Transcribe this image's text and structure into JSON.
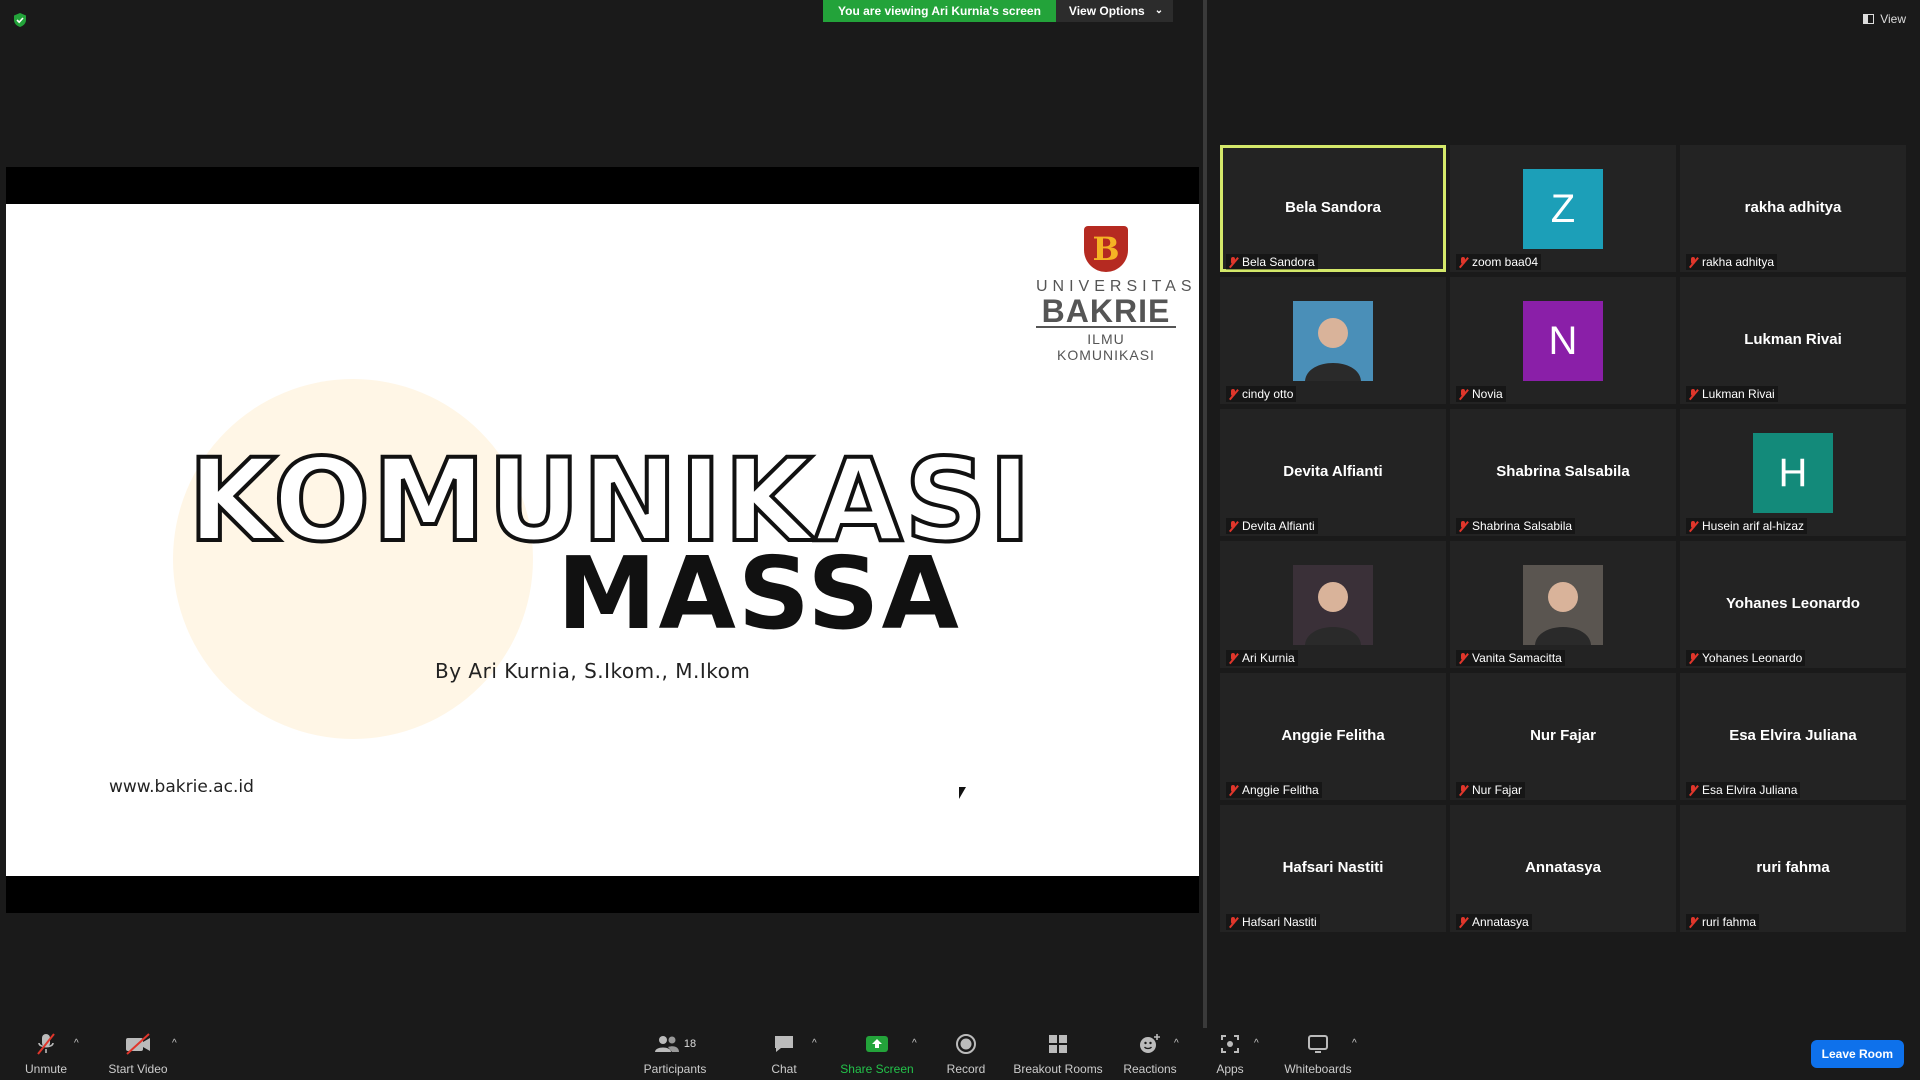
{
  "banner": {
    "viewing_text": "You are viewing Ari Kurnia's screen",
    "view_options": "View Options"
  },
  "top_right": {
    "view_label": "View"
  },
  "slide": {
    "title_outline": "KOMUNIKASI",
    "title_solid": "MASSA",
    "byline": "By Ari Kurnia, S.Ikom., M.Ikom",
    "website": "www.bakrie.ac.id",
    "logo": {
      "mark": "B",
      "line1": "UNIVERSITAS",
      "line2": "BAKRIE",
      "line3": "ILMU KOMUNIKASI"
    }
  },
  "participants": [
    {
      "center": "Bela Sandora",
      "label": "Bela Sandora",
      "type": "name",
      "active": true
    },
    {
      "center": "Z",
      "label": "zoom baa04",
      "type": "letter",
      "color": "#1c9fb8"
    },
    {
      "center": "rakha adhitya",
      "label": "rakha adhitya",
      "type": "name"
    },
    {
      "center": "",
      "label": "cindy otto",
      "type": "photo",
      "color": "#4a8fb8"
    },
    {
      "center": "N",
      "label": "Novia",
      "type": "letter",
      "color": "#8a1fa8"
    },
    {
      "center": "Lukman Rivai",
      "label": "Lukman Rivai",
      "type": "name"
    },
    {
      "center": "Devita Alfianti",
      "label": "Devita Alfianti",
      "type": "name"
    },
    {
      "center": "Shabrina Salsabila",
      "label": "Shabrina Salsabila",
      "type": "name"
    },
    {
      "center": "H",
      "label": "Husein arif al-hizaz",
      "type": "letter",
      "color": "#138a7a"
    },
    {
      "center": "",
      "label": "Ari Kurnia",
      "type": "photo",
      "color": "#3a3038"
    },
    {
      "center": "",
      "label": "Vanita Samacitta",
      "type": "photo",
      "color": "#5a5550"
    },
    {
      "center": "Yohanes Leonardo",
      "label": "Yohanes Leonardo",
      "type": "name"
    },
    {
      "center": "Anggie Felitha",
      "label": "Anggie Felitha",
      "type": "name"
    },
    {
      "center": "Nur Fajar",
      "label": "Nur Fajar",
      "type": "name"
    },
    {
      "center": "Esa Elvira Juliana",
      "label": "Esa Elvira Juliana",
      "type": "name"
    },
    {
      "center": "Hafsari Nastiti",
      "label": "Hafsari Nastiti",
      "type": "name"
    },
    {
      "center": "Annatasya",
      "label": "Annatasya",
      "type": "name"
    },
    {
      "center": "ruri fahma",
      "label": "ruri fahma",
      "type": "name"
    }
  ],
  "toolbar": {
    "unmute": "Unmute",
    "start_video": "Start Video",
    "participants": "Participants",
    "participants_count": "18",
    "chat": "Chat",
    "share_screen": "Share Screen",
    "record": "Record",
    "breakout_rooms": "Breakout Rooms",
    "reactions": "Reactions",
    "apps": "Apps",
    "whiteboards": "Whiteboards",
    "leave_room": "Leave Room"
  },
  "colors": {
    "share_green": "#23a33a",
    "active_outline": "#d4e86a",
    "leave_blue": "#0e71eb",
    "muted_red": "#e0362b"
  }
}
